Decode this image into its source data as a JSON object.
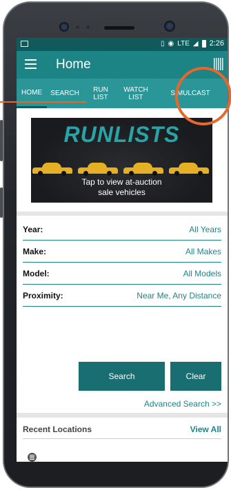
{
  "statusbar": {
    "network": "LTE",
    "time": "2:26"
  },
  "appbar": {
    "title": "Home",
    "icons": [
      "menu-icon",
      "barcode-icon"
    ]
  },
  "tabs": [
    {
      "label": "HOME",
      "active": true
    },
    {
      "label": "SEARCH"
    },
    {
      "label": "RUN\nLIST"
    },
    {
      "label": "WATCH\nLIST"
    },
    {
      "label": "SIMULCAST"
    }
  ],
  "banner": {
    "title": "RUNLISTS",
    "subtitle_line1": "Tap to view at-auction",
    "subtitle_line2": "sale vehicles"
  },
  "form": {
    "rows": [
      {
        "label": "Year:",
        "value": "All Years"
      },
      {
        "label": "Make:",
        "value": "All Makes"
      },
      {
        "label": "Model:",
        "value": "All Models"
      },
      {
        "label": "Proximity:",
        "value": "Near Me, Any Distance"
      }
    ],
    "search_label": "Search",
    "clear_label": "Clear",
    "advanced_label": "Advanced Search >>"
  },
  "recent": {
    "title": "Recent Locations",
    "view_all": "View All"
  },
  "colors": {
    "primary": "#1d8486",
    "dark": "#0f5a5a",
    "accent": "#e8672a",
    "button": "#186e70"
  }
}
